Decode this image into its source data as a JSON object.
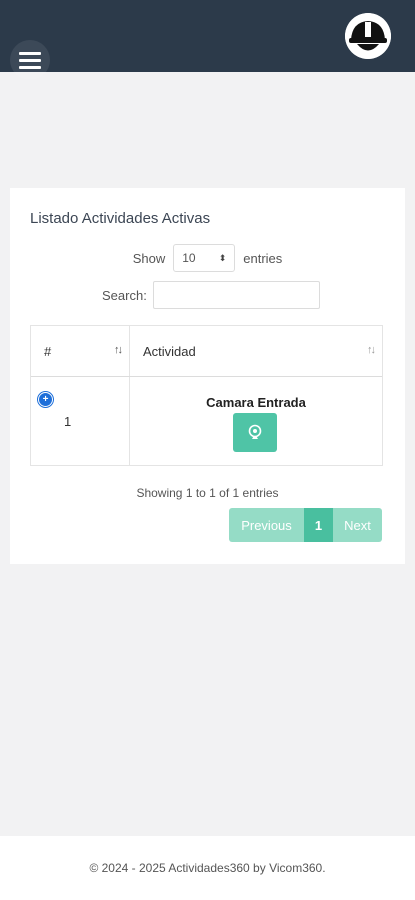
{
  "header": {
    "menu_icon": "hamburger-menu-icon",
    "avatar_icon": "helmet-avatar-icon"
  },
  "card": {
    "title": "Listado Actividades Activas",
    "length": {
      "show_label": "Show",
      "selected": "10",
      "entries_label": "entries"
    },
    "search": {
      "label": "Search:",
      "value": "",
      "placeholder": ""
    },
    "table": {
      "columns": [
        "#",
        "Actividad"
      ],
      "rows": [
        {
          "num": "1",
          "actividad": "Camara Entrada",
          "action_icon": "webcam-icon"
        }
      ]
    },
    "info": "Showing 1 to 1 of 1 entries",
    "pagination": {
      "previous": "Previous",
      "current": "1",
      "next": "Next"
    }
  },
  "footer": {
    "text": "© 2024 - 2025 Actividades360 by Vicom360."
  },
  "colors": {
    "header_bg": "#2c3a4a",
    "accent": "#4fc4a6",
    "accent_light": "#95dcc6",
    "expand": "#1e6fd9"
  }
}
